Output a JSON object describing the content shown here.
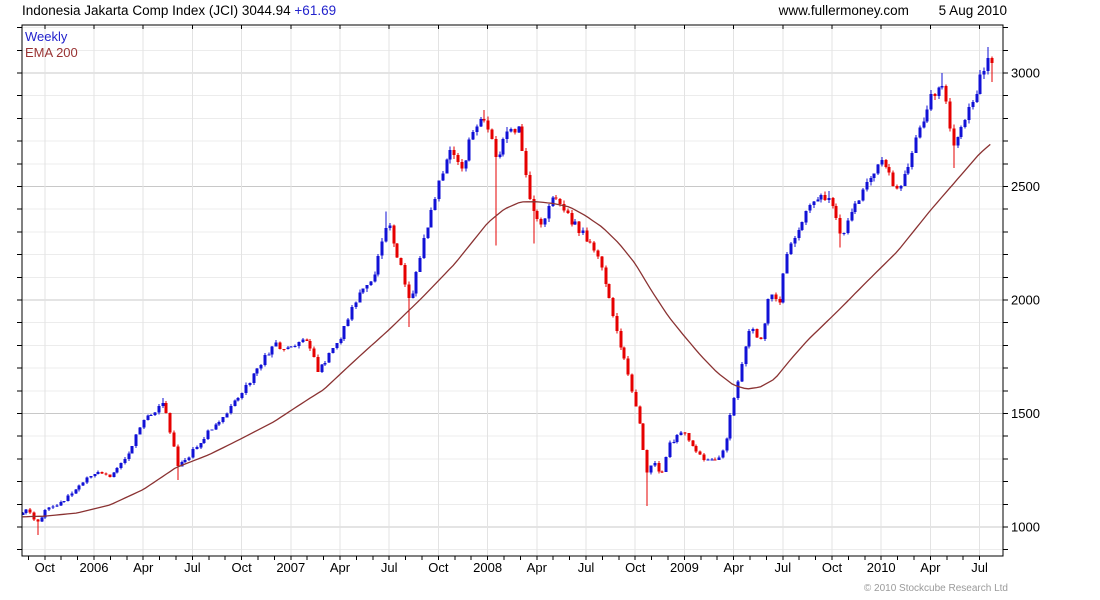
{
  "header": {
    "title": "Indonesia Jakarta Comp Index (JCI) 3044.94",
    "change": "+61.69",
    "site": "www.fullermoney.com",
    "date": "5 Aug 2010"
  },
  "legend": {
    "series1": "Weekly",
    "series2": "EMA 200"
  },
  "footer": {
    "copyright": "© 2010 Stockcube Research Ltd"
  },
  "colors": {
    "up": "#1111d6",
    "down": "#e60000",
    "ema": "#8a3232",
    "grid_minor": "#ececec",
    "grid_major": "#c8c8c8",
    "grid_vertical": "#e3e3e3",
    "border": "#000000",
    "label": "#000000",
    "copyright": "#9a9a9a",
    "legend_weekly": "#2222cc",
    "legend_ema": "#993333"
  },
  "chart_data": {
    "type": "candlestick+line",
    "timeframe": "weekly",
    "title": "Indonesia Jakarta Comp Index (JCI)",
    "last_close": 3044.94,
    "last_change": 61.69,
    "x_range": [
      "2005-08",
      "2010-08"
    ],
    "y_axis": {
      "labeled_ticks": [
        1000,
        1500,
        2000,
        2500,
        3000
      ],
      "minor_step": 100,
      "visible_range": [
        880,
        3210
      ]
    },
    "x_axis_labels": [
      {
        "label": "Oct",
        "m": 2
      },
      {
        "label": "2006",
        "m": 5
      },
      {
        "label": "Apr",
        "m": 8
      },
      {
        "label": "Jul",
        "m": 11
      },
      {
        "label": "Oct",
        "m": 14
      },
      {
        "label": "2007",
        "m": 17
      },
      {
        "label": "Apr",
        "m": 20
      },
      {
        "label": "Jul",
        "m": 23
      },
      {
        "label": "Oct",
        "m": 26
      },
      {
        "label": "2008",
        "m": 29
      },
      {
        "label": "Apr",
        "m": 32
      },
      {
        "label": "Jul",
        "m": 35
      },
      {
        "label": "Oct",
        "m": 38
      },
      {
        "label": "2009",
        "m": 41
      },
      {
        "label": "Apr",
        "m": 44
      },
      {
        "label": "Jul",
        "m": 47
      },
      {
        "label": "Oct",
        "m": 50
      },
      {
        "label": "2010",
        "m": 53
      },
      {
        "label": "Apr",
        "m": 56
      },
      {
        "label": "Jul",
        "m": 59
      }
    ],
    "note": "m = months since 2005-08-01; weekly candles interpolated from these close anchors read off the chart",
    "close_anchors": [
      [
        0.65,
        1060
      ],
      [
        1,
        1085
      ],
      [
        1.5,
        1010
      ],
      [
        2,
        1070
      ],
      [
        3,
        1105
      ],
      [
        4,
        1170
      ],
      [
        5,
        1240
      ],
      [
        6,
        1225
      ],
      [
        7,
        1310
      ],
      [
        8,
        1465
      ],
      [
        9.3,
        1550
      ],
      [
        10.1,
        1270
      ],
      [
        10.7,
        1300
      ],
      [
        11,
        1330
      ],
      [
        12,
        1420
      ],
      [
        13,
        1500
      ],
      [
        14,
        1580
      ],
      [
        15,
        1710
      ],
      [
        16,
        1800
      ],
      [
        17,
        1780
      ],
      [
        17.9,
        1845
      ],
      [
        18.7,
        1680
      ],
      [
        19.5,
        1790
      ],
      [
        20,
        1830
      ],
      [
        21,
        2000
      ],
      [
        22,
        2090
      ],
      [
        22.9,
        2360
      ],
      [
        23.6,
        2170
      ],
      [
        24.3,
        1995
      ],
      [
        25,
        2230
      ],
      [
        26,
        2520
      ],
      [
        26.7,
        2660
      ],
      [
        27.4,
        2560
      ],
      [
        28,
        2720
      ],
      [
        28.9,
        2810
      ],
      [
        29.6,
        2580
      ],
      [
        30,
        2720
      ],
      [
        30.9,
        2750
      ],
      [
        31.6,
        2420
      ],
      [
        32.2,
        2310
      ],
      [
        33,
        2445
      ],
      [
        34,
        2360
      ],
      [
        35,
        2280
      ],
      [
        36,
        2140
      ],
      [
        37,
        1840
      ],
      [
        38.3,
        1450
      ],
      [
        38.7,
        1245
      ],
      [
        39.2,
        1290
      ],
      [
        39.6,
        1215
      ],
      [
        40,
        1355
      ],
      [
        41,
        1430
      ],
      [
        41.7,
        1330
      ],
      [
        42.2,
        1300
      ],
      [
        43,
        1285
      ],
      [
        43.5,
        1365
      ],
      [
        44,
        1560
      ],
      [
        45,
        1885
      ],
      [
        45.7,
        1825
      ],
      [
        46.2,
        2030
      ],
      [
        46.8,
        1975
      ],
      [
        47.2,
        2200
      ],
      [
        48,
        2330
      ],
      [
        49,
        2440
      ],
      [
        49.9,
        2470
      ],
      [
        50.6,
        2265
      ],
      [
        51.2,
        2400
      ],
      [
        52,
        2500
      ],
      [
        53,
        2620
      ],
      [
        53.9,
        2485
      ],
      [
        54.6,
        2565
      ],
      [
        55,
        2670
      ],
      [
        56,
        2890
      ],
      [
        56.8,
        2965
      ],
      [
        57.4,
        2665
      ],
      [
        58,
        2790
      ],
      [
        58.9,
        2945
      ],
      [
        59.5,
        3085
      ],
      [
        59.8,
        3044.94
      ]
    ],
    "low_spikes": [
      [
        1.5,
        965
      ],
      [
        10.2,
        1207
      ],
      [
        24.3,
        1880
      ],
      [
        29.4,
        2240
      ],
      [
        31.8,
        2250
      ],
      [
        38.8,
        1092
      ],
      [
        50.5,
        2232
      ],
      [
        57.4,
        2582
      ]
    ],
    "high_spikes": [
      [
        9.3,
        1568
      ],
      [
        22.9,
        2390
      ],
      [
        28.9,
        2838
      ],
      [
        49.9,
        2480
      ],
      [
        56.8,
        3000
      ],
      [
        59.5,
        3114
      ]
    ],
    "ema200": [
      [
        0.65,
        1045
      ],
      [
        2,
        1048
      ],
      [
        4,
        1062
      ],
      [
        6,
        1098
      ],
      [
        8,
        1165
      ],
      [
        10,
        1262
      ],
      [
        12,
        1318
      ],
      [
        14,
        1390
      ],
      [
        16,
        1465
      ],
      [
        18,
        1560
      ],
      [
        19,
        1605
      ],
      [
        21,
        1740
      ],
      [
        23,
        1870
      ],
      [
        25,
        2010
      ],
      [
        27,
        2160
      ],
      [
        29,
        2340
      ],
      [
        30,
        2400
      ],
      [
        31,
        2432
      ],
      [
        32,
        2433
      ],
      [
        33,
        2425
      ],
      [
        34,
        2410
      ],
      [
        35,
        2370
      ],
      [
        36,
        2320
      ],
      [
        37,
        2250
      ],
      [
        38,
        2160
      ],
      [
        39,
        2040
      ],
      [
        40,
        1930
      ],
      [
        41,
        1840
      ],
      [
        42,
        1755
      ],
      [
        43,
        1680
      ],
      [
        44,
        1625
      ],
      [
        44.8,
        1608
      ],
      [
        45.6,
        1616
      ],
      [
        46.5,
        1652
      ],
      [
        47.5,
        1740
      ],
      [
        48.5,
        1822
      ],
      [
        49.5,
        1892
      ],
      [
        50.5,
        1962
      ],
      [
        52,
        2072
      ],
      [
        54,
        2215
      ],
      [
        56,
        2395
      ],
      [
        57.5,
        2520
      ],
      [
        59,
        2645
      ],
      [
        59.8,
        2695
      ]
    ]
  }
}
